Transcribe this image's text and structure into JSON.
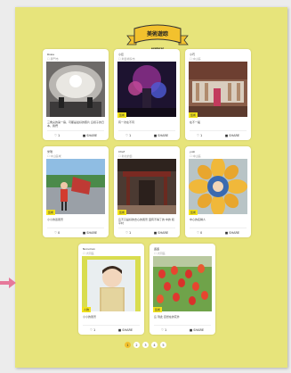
{
  "banner": {
    "title": "美術遊踪",
    "subtitle": "explorer"
  },
  "cards": [
    {
      "user": "Rosie",
      "location": "☐ 廈門市",
      "tag": "",
      "caption": "三角尖的第一扇，可都是最好的照片 這樣子的日本，我們",
      "likes": "1",
      "share": "SHARE"
    },
    {
      "user": "小巨",
      "location": "☐ 新藝術館市",
      "tag": "藝術",
      "caption": "有一次在不同",
      "likes": "1",
      "share": "SHARE"
    },
    {
      "user": "小巧",
      "location": "☐ 中山區",
      "tag": "藝術",
      "caption": "在不一般",
      "likes": "1",
      "share": "SHARE"
    },
    {
      "user": "米瑞",
      "location": "☐ 中山區域",
      "tag": "藝術",
      "caption": "小小的蓋風景",
      "likes": "0",
      "share": "SHARE"
    },
    {
      "user": "Chef",
      "location": "☐ 新北的藝",
      "tag": "藝術",
      "caption": "這不只是好的去心的風景 還有不得了的 中的 和平村",
      "likes": "1",
      "share": "SHARE"
    },
    {
      "user": "yuki",
      "location": "☐ 中山區",
      "tag": "藝術",
      "caption": "中心的名稱人",
      "likes": "0",
      "share": "SHARE"
    },
    {
      "user": "Noruman",
      "location": "☐ 大同區",
      "tag": "人物",
      "caption": "小小的風景",
      "likes": "1",
      "share": "SHARE"
    },
    {
      "user": "遊遊",
      "location": "☐ 大同區",
      "tag": "藝術",
      "caption": "這 到此 自然在的花外",
      "likes": "1",
      "share": "SHARE"
    }
  ],
  "pagination": [
    "1",
    "2",
    "3",
    "4",
    "5"
  ],
  "colors": {
    "page_bg": "#e7e47b",
    "accent": "#f2c12e",
    "tag": "#f2e21a"
  }
}
